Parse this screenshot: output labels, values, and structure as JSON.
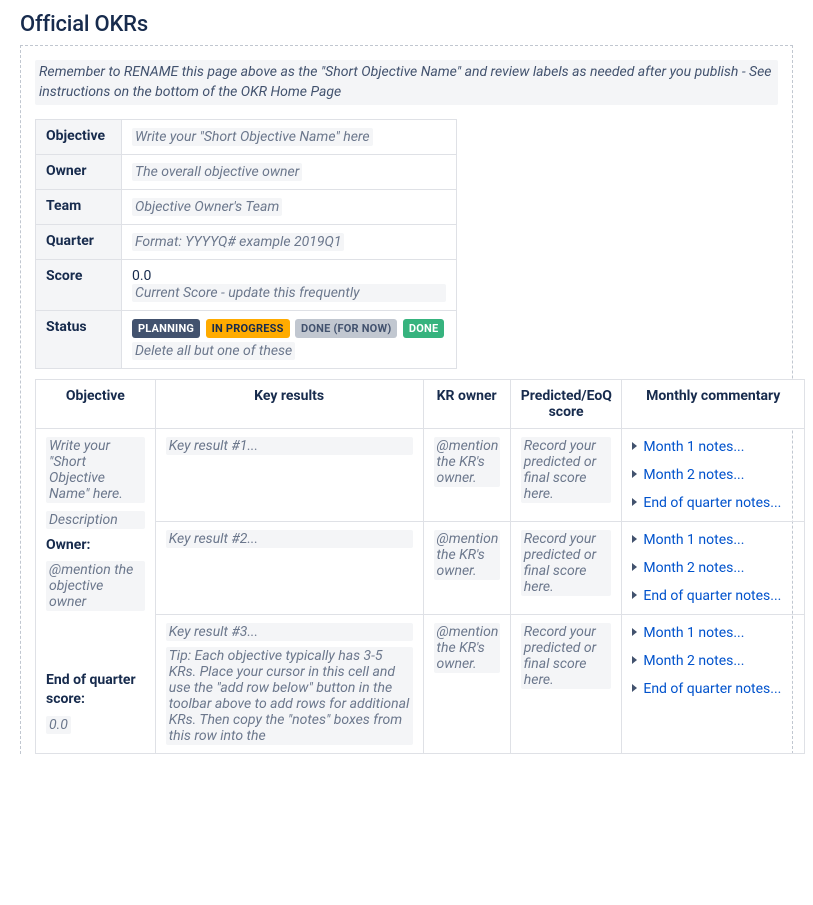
{
  "pageTitle": "Official OKRs",
  "banner": "Remember to RENAME this page above as the \"Short Objective Name\" and review labels as needed after you publish - See instructions on the bottom of the OKR Home Page",
  "meta": {
    "objective": {
      "label": "Objective",
      "ph": "Write your \"Short Objective Name\" here"
    },
    "owner": {
      "label": "Owner",
      "ph": "The overall objective owner"
    },
    "team": {
      "label": "Team",
      "ph": "Objective Owner's Team"
    },
    "quarter": {
      "label": "Quarter",
      "ph": "Format: YYYYQ# example 2019Q1"
    },
    "score": {
      "label": "Score",
      "value": "0.0",
      "ph": "Current Score - update this frequently"
    },
    "status": {
      "label": "Status",
      "deleteHint": "Delete all but one of these"
    }
  },
  "statusChips": {
    "planning": "PLANNING",
    "inProgress": "IN PROGRESS",
    "doneForNow": "DONE (FOR NOW)",
    "done": "DONE"
  },
  "headers": {
    "objective": "Objective",
    "keyResults": "Key results",
    "krOwner": "KR owner",
    "score": "Predicted/EoQ score",
    "commentary": "Monthly commentary"
  },
  "objectiveCell": {
    "namePh": "Write your \"Short Objective Name\" here.",
    "descPh": "Description",
    "ownerLabel": "Owner:",
    "ownerPh": "@mention the objective owner",
    "eoqLabel": "End of quarter score:",
    "eoqScorePh": "0.0"
  },
  "rows": [
    {
      "krPh": "Key result #1...",
      "ownerPh": "@mention the KR's owner.",
      "scorePh": "Record your predicted or final score here.",
      "m1": "Month 1 notes...",
      "m2": "Month 2 notes...",
      "eoq": "End of quarter notes..."
    },
    {
      "krPh": "Key result #2...",
      "ownerPh": "@mention the KR's owner.",
      "scorePh": "Record your predicted or final score here.",
      "m1": "Month 1 notes...",
      "m2": "Month 2 notes...",
      "eoq": "End of quarter notes..."
    },
    {
      "krPh": "Key result #3...",
      "tipPh": "Tip: Each objective typically has 3-5 KRs. Place your cursor in this cell and use the \"add row below\" button in the toolbar above to add rows for additional KRs. Then copy the \"notes\" boxes from this row into the",
      "ownerPh": "@mention the KR's owner.",
      "scorePh": "Record your predicted or final score here.",
      "m1": "Month 1 notes...",
      "m2": "Month 2 notes...",
      "eoq": "End of quarter notes..."
    }
  ]
}
